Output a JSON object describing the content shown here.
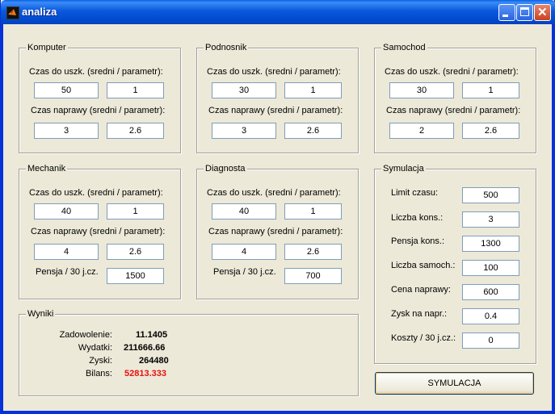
{
  "window": {
    "title": "analiza"
  },
  "panels": {
    "komputer": {
      "title": "Komputer",
      "fail_label": "Czas do uszk. (sredni / parametr):",
      "fail_mean": "50",
      "fail_param": "1",
      "repair_label": "Czas naprawy (sredni / parametr):",
      "repair_mean": "3",
      "repair_param": "2.6"
    },
    "podnosnik": {
      "title": "Podnosnik",
      "fail_label": "Czas do uszk. (sredni / parametr):",
      "fail_mean": "30",
      "fail_param": "1",
      "repair_label": "Czas naprawy (sredni / parametr):",
      "repair_mean": "3",
      "repair_param": "2.6"
    },
    "samochod": {
      "title": "Samochod",
      "fail_label": "Czas do uszk. (sredni / parametr):",
      "fail_mean": "30",
      "fail_param": "1",
      "repair_label": "Czas naprawy (sredni / parametr):",
      "repair_mean": "2",
      "repair_param": "2.6"
    },
    "mechanik": {
      "title": "Mechanik",
      "fail_label": "Czas do uszk. (sredni / parametr):",
      "fail_mean": "40",
      "fail_param": "1",
      "repair_label": "Czas naprawy (sredni / parametr):",
      "repair_mean": "4",
      "repair_param": "2.6",
      "salary_label": "Pensja / 30 j.cz.",
      "salary": "1500"
    },
    "diagnosta": {
      "title": "Diagnosta",
      "fail_label": "Czas do uszk. (sredni / parametr):",
      "fail_mean": "40",
      "fail_param": "1",
      "repair_label": "Czas naprawy (sredni / parametr):",
      "repair_mean": "4",
      "repair_param": "2.6",
      "salary_label": "Pensja / 30 j.cz.",
      "salary": "700"
    }
  },
  "symulacja": {
    "title": "Symulacja",
    "limit_label": "Limit czasu:",
    "limit": "500",
    "clients_label": "Liczba kons.:",
    "clients": "3",
    "salary_label": "Pensja kons.:",
    "salary": "1300",
    "cars_label": "Liczba samoch.:",
    "cars": "100",
    "price_label": "Cena naprawy:",
    "price": "600",
    "profit_label": "Zysk na napr.:",
    "profit": "0.4",
    "costs_label": "Koszty / 30 j.cz.:",
    "costs": "0",
    "button_label": "SYMULACJA"
  },
  "wyniki": {
    "title": "Wyniki",
    "satisfaction_label": "Zadowolenie:",
    "satisfaction": "11.1405",
    "expenses_label": "Wydatki:",
    "expenses": "211666.66",
    "profits_label": "Zyski:",
    "profits": "264480",
    "balance_label": "Bilans:",
    "balance": "52813.333",
    "balance_color": "#e81010"
  },
  "icons": {
    "app": "matlab-icon",
    "minimize": "minimize-icon",
    "maximize": "maximize-icon",
    "close": "close-icon"
  }
}
